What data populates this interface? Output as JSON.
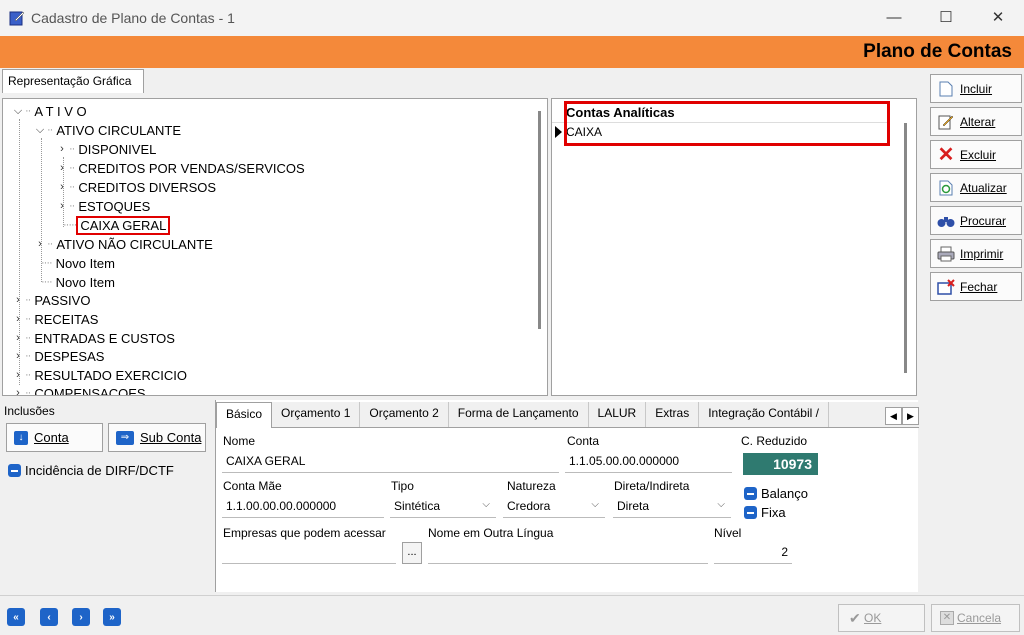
{
  "window": {
    "title": "Cadastro de Plano de Contas - 1",
    "minimize": "—",
    "maximize": "☐",
    "close": "✕"
  },
  "banner": {
    "title": "Plano de Contas"
  },
  "tab_header": "Representação Gráfica",
  "tree": {
    "ativo": "A T I V O",
    "ativo_circulante": "ATIVO CIRCULANTE",
    "disponivel": "DISPONIVEL",
    "creditos_vendas": "CREDITOS POR VENDAS/SERVICOS",
    "creditos_diversos": "CREDITOS DIVERSOS",
    "estoques": "ESTOQUES",
    "caixa_geral": "CAIXA GERAL",
    "ativo_nao_circulante": "ATIVO NÃO CIRCULANTE",
    "novo_item_1": "Novo Item",
    "novo_item_2": "Novo Item",
    "passivo": "PASSIVO",
    "receitas": "RECEITAS",
    "entradas_custos": "ENTRADAS E CUSTOS",
    "despesas": "DESPESAS",
    "resultado_exercicio": "RESULTADO EXERCICIO",
    "compensacoes": "COMPENSACOES"
  },
  "grid": {
    "header": "Contas Analíticas",
    "rows": [
      "CAIXA"
    ]
  },
  "sidebar": {
    "incluir": "Incluir",
    "alterar": "Alterar",
    "excluir": "Excluir",
    "atualizar": "Atualizar",
    "procurar": "Procurar",
    "imprimir": "Imprimir",
    "fechar": "Fechar"
  },
  "inclusoes": {
    "title": "Inclusões",
    "conta": "Conta",
    "sub_conta": "Sub Conta",
    "dirf": "Incidência de DIRF/DCTF"
  },
  "tabs": [
    "Básico",
    "Orçamento 1",
    "Orçamento 2",
    "Forma de Lançamento",
    "LALUR",
    "Extras",
    "Integração Contábil /"
  ],
  "form": {
    "nome_label": "Nome",
    "nome_value": "CAIXA GERAL",
    "conta_label": "Conta",
    "conta_value": "1.1.05.00.00.000000",
    "reduzido_label": "C. Reduzido",
    "reduzido_value": "10973",
    "conta_mae_label": "Conta Mãe",
    "conta_mae_value": "1.1.00.00.00.000000",
    "tipo_label": "Tipo",
    "tipo_value": "Sintética",
    "natureza_label": "Natureza",
    "natureza_value": "Credora",
    "direta_label": "Direta/Indireta",
    "direta_value": "Direta",
    "balanco": "Balanço",
    "fixa": "Fixa",
    "empresas_label": "Empresas que podem acessar",
    "empresas_btn": "...",
    "outra_lingua_label": "Nome em Outra Língua",
    "nivel_label": "Nível",
    "nivel_value": "2"
  },
  "bottom": {
    "ok": "OK",
    "cancela": "Cancela"
  }
}
